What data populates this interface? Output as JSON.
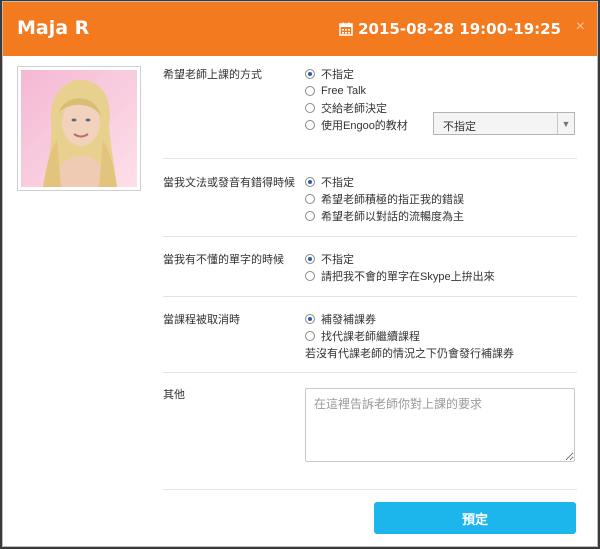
{
  "header": {
    "teacher_name": "Maja R",
    "datetime": "2015-08-28 19:00-19:25",
    "close_label": "×"
  },
  "q1": {
    "label": "希望老師上課的方式",
    "options": [
      "不指定",
      "Free Talk",
      "交給老師決定",
      "使用Engoo的教材"
    ],
    "selected": 0,
    "material_select": "不指定"
  },
  "q2": {
    "label": "當我文法或發音有錯得時候",
    "options": [
      "不指定",
      "希望老師積極的指正我的錯誤",
      "希望老師以對話的流暢度為主"
    ],
    "selected": 0
  },
  "q3": {
    "label": "當我有不懂的單字的時候",
    "options": [
      "不指定",
      "請把我不會的單字在Skype上拚出來"
    ],
    "selected": 0
  },
  "q4": {
    "label": "當課程被取消時",
    "options": [
      "補發補課券",
      "找代課老師繼續課程"
    ],
    "selected": 0,
    "note": "若沒有代課老師的情況之下仍會發行補課券"
  },
  "other": {
    "label": "其他",
    "placeholder": "在這裡告訴老師你對上課的要求"
  },
  "submit_label": "預定",
  "colors": {
    "header": "#f37a1e",
    "button": "#1cb6ec"
  }
}
